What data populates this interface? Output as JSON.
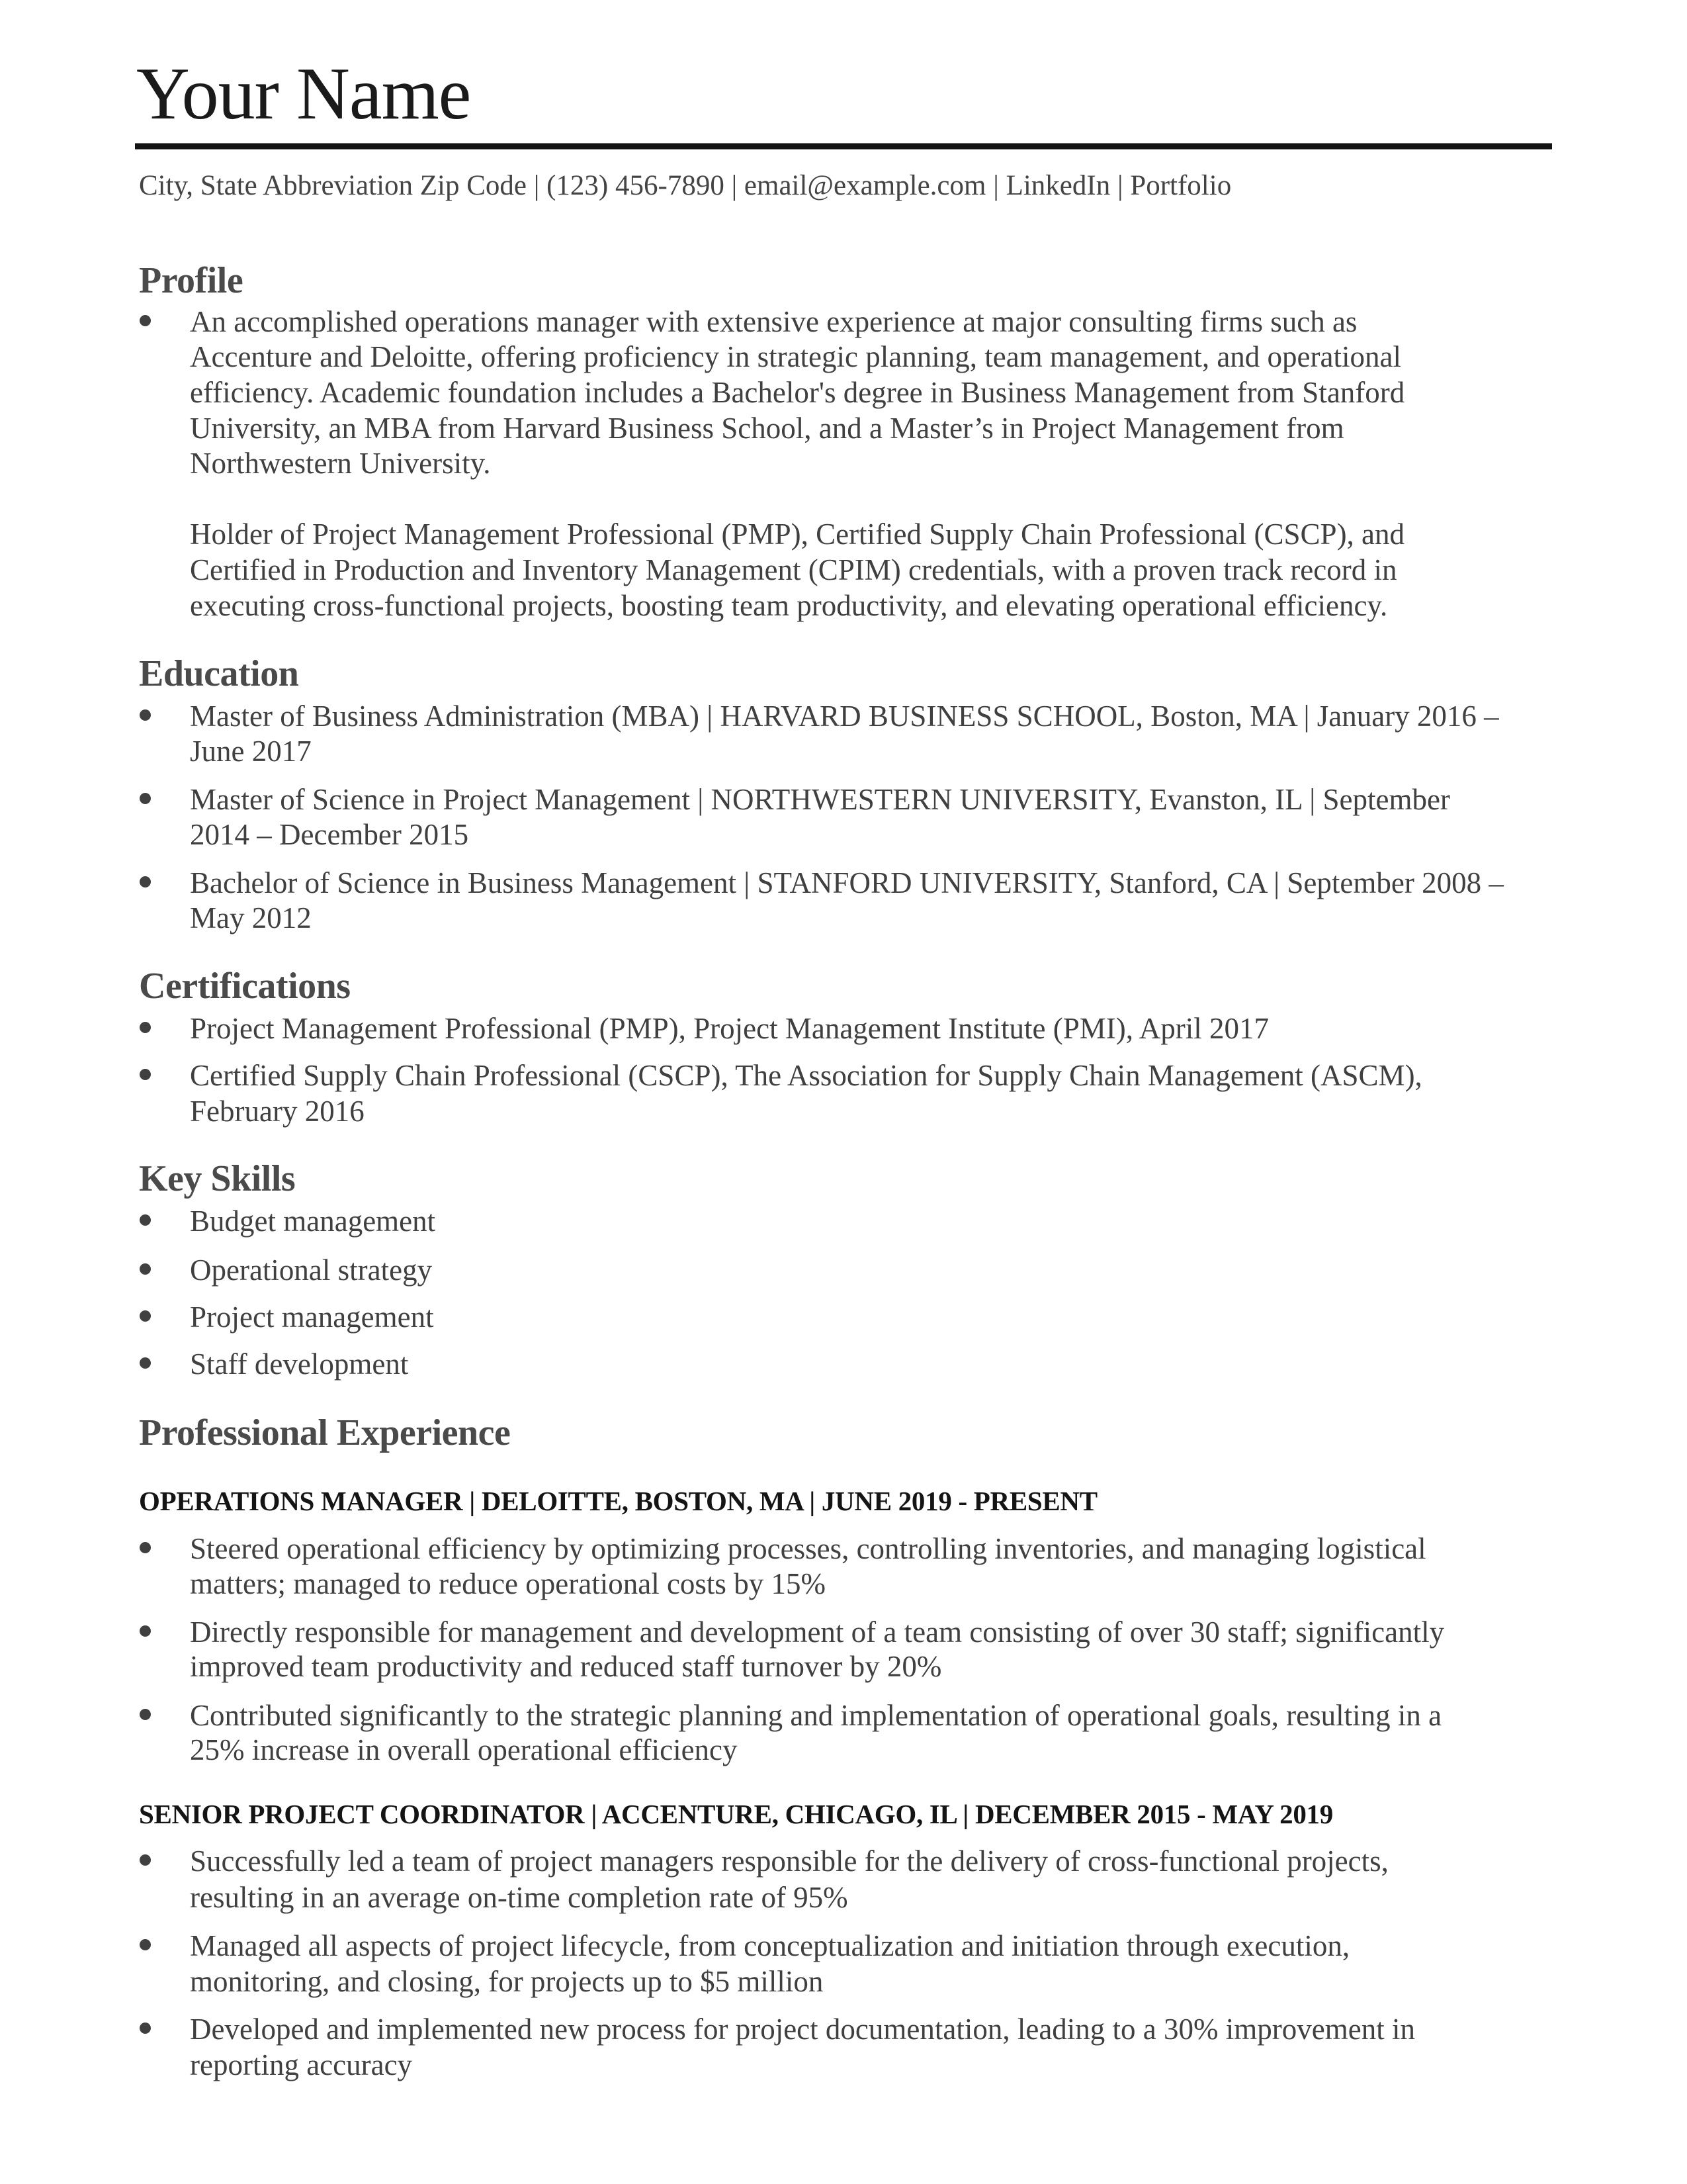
{
  "header": {
    "name": "Your Name",
    "contact": "City, State Abbreviation Zip Code | (123) 456-7890 | email@example.com | LinkedIn | Portfolio"
  },
  "profile": {
    "heading": "Profile",
    "paragraph1_lines": [
      "An accomplished operations manager with extensive experience at major consulting firms such as",
      "Accenture and Deloitte, offering proficiency in strategic planning, team management, and operational",
      "efficiency. Academic foundation includes a Bachelor's degree in Business Management from Stanford",
      "University, an MBA from Harvard Business School, and a Master’s in Project Management from",
      "Northwestern University."
    ],
    "paragraph2_lines": [
      "Holder of Project Management Professional (PMP), Certified Supply Chain Professional (CSCP), and",
      "Certified in Production and Inventory Management (CPIM) credentials, with a proven track record in",
      "executing cross-functional projects, boosting team productivity, and elevating operational efficiency."
    ]
  },
  "education": {
    "heading": "Education",
    "items": [
      {
        "lines": [
          "Master of Business Administration (MBA) | HARVARD BUSINESS SCHOOL, Boston, MA | January 2016 –",
          "June 2017"
        ]
      },
      {
        "lines": [
          "Master of Science in Project Management | NORTHWESTERN UNIVERSITY, Evanston, IL | September",
          "2014 – December 2015"
        ]
      },
      {
        "lines": [
          "Bachelor of Science in Business Management | STANFORD UNIVERSITY, Stanford, CA | September 2008 –",
          "May 2012"
        ]
      }
    ]
  },
  "certifications": {
    "heading": "Certifications",
    "items": [
      {
        "lines": [
          "Project Management Professional (PMP), Project Management Institute (PMI), April 2017"
        ]
      },
      {
        "lines": [
          "Certified Supply Chain Professional (CSCP), The Association for Supply Chain Management (ASCM),",
          "February 2016"
        ]
      }
    ]
  },
  "skills": {
    "heading": "Key Skills",
    "items": [
      "Budget management",
      "Operational strategy",
      "Project management",
      "Staff development"
    ]
  },
  "experience": {
    "heading": "Professional Experience",
    "jobs": [
      {
        "title": "OPERATIONS MANAGER | DELOITTE, BOSTON, MA | JUNE 2019 - PRESENT",
        "bullets": [
          {
            "lines": [
              "Steered operational efficiency by optimizing processes, controlling inventories, and managing logistical",
              "matters; managed to reduce operational costs by 15%"
            ]
          },
          {
            "lines": [
              "Directly responsible for management and development of a team consisting of over 30 staff; significantly",
              "improved team productivity and reduced staff turnover by 20%"
            ]
          },
          {
            "lines": [
              "Contributed significantly to the strategic planning and implementation of operational goals, resulting in a",
              "25% increase in overall operational efficiency"
            ]
          }
        ]
      },
      {
        "title": "SENIOR PROJECT COORDINATOR | ACCENTURE, CHICAGO, IL | DECEMBER 2015 - MAY 2019",
        "bullets": [
          {
            "lines": [
              "Successfully led a team of project managers responsible for the delivery of cross-functional projects,",
              "resulting in an average on-time completion rate of 95%"
            ]
          },
          {
            "lines": [
              "Managed all aspects of project lifecycle, from conceptualization and initiation through execution,",
              "monitoring, and closing, for projects up to $5 million"
            ]
          },
          {
            "lines": [
              "Developed and implemented new process for project documentation, leading to a 30% improvement in",
              "reporting accuracy"
            ]
          }
        ]
      }
    ]
  }
}
